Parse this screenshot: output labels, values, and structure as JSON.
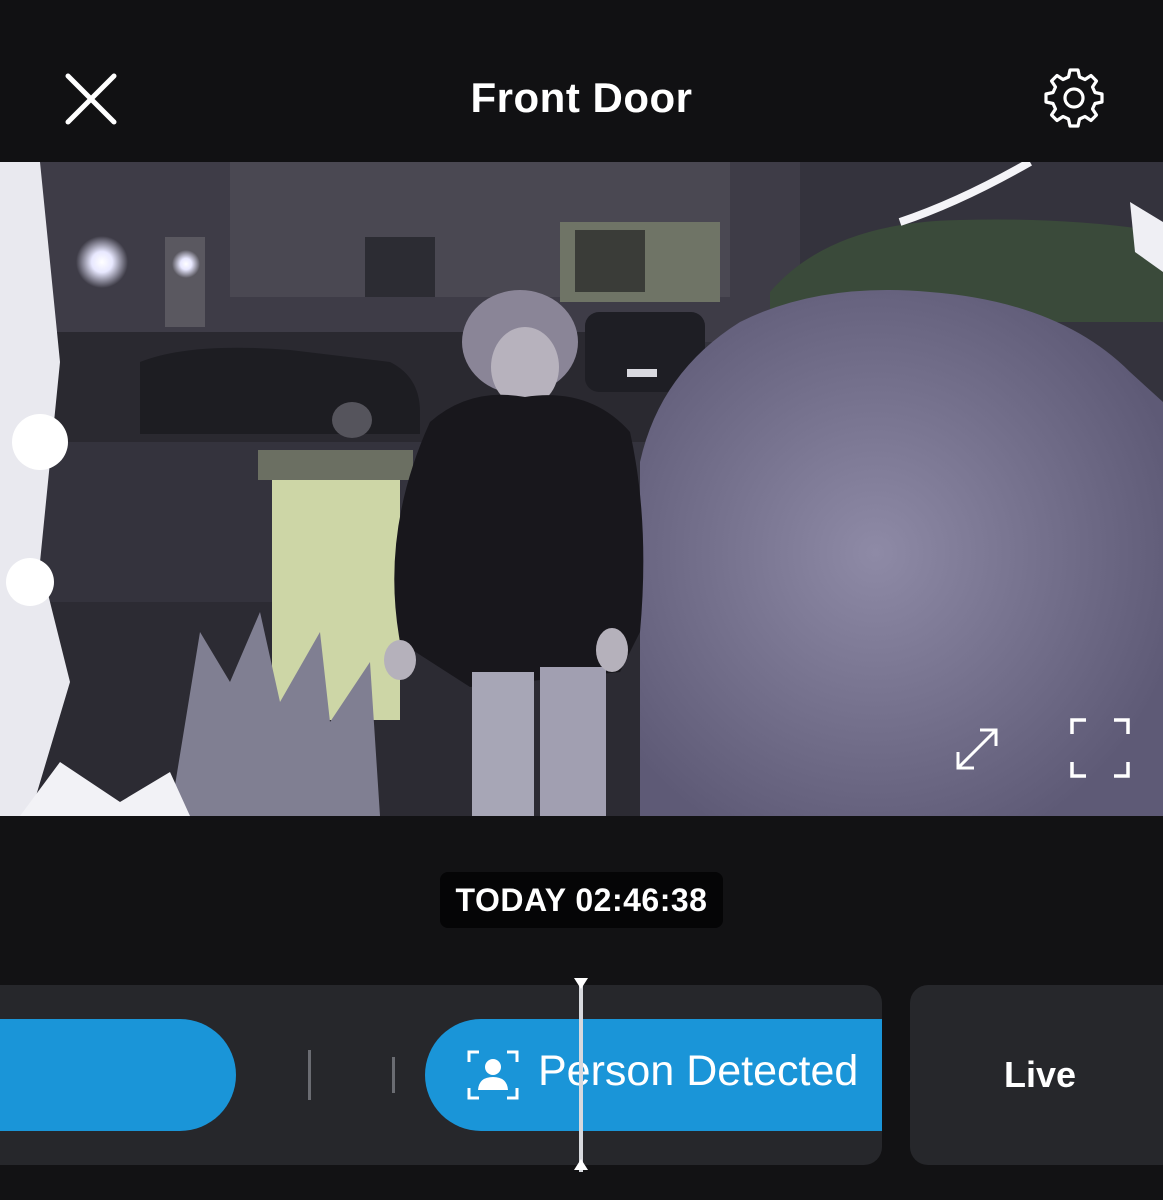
{
  "header": {
    "title": "Front Door",
    "close_icon": "close-icon",
    "settings_icon": "gear-icon"
  },
  "video": {
    "expand_icon": "expand-arrows-icon",
    "fullscreen_icon": "fullscreen-corners-icon"
  },
  "timestamp": "TODAY 02:46:38",
  "timeline": {
    "events": [
      {
        "label": "",
        "type": "event"
      },
      {
        "label": "Person Detected",
        "type": "person",
        "icon": "person-frame-icon"
      }
    ],
    "live_label": "Live"
  },
  "colors": {
    "accent": "#1a95d8",
    "background": "#121214",
    "panel": "#26272b"
  }
}
